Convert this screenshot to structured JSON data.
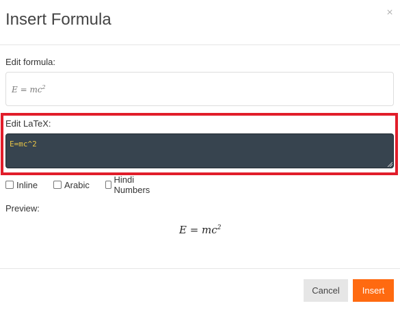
{
  "dialog": {
    "title": "Insert Formula",
    "close_glyph": "×",
    "close_icon": "close-icon"
  },
  "formula": {
    "label": "Edit formula:",
    "rendered_base": "E = mc",
    "rendered_exp": "2"
  },
  "latex": {
    "label": "Edit LaTeX:",
    "value": "E=mc^2",
    "text_color": "#e8c547",
    "background": "#37444f",
    "highlight_color": "#e11d2a"
  },
  "options": [
    {
      "label": "Inline",
      "checked": false
    },
    {
      "label": "Arabic",
      "checked": false
    },
    {
      "label": "Hindi Numbers",
      "checked": false
    }
  ],
  "preview": {
    "label": "Preview:",
    "rendered_base": "E = mc",
    "rendered_exp": "2"
  },
  "footer": {
    "cancel_label": "Cancel",
    "insert_label": "Insert",
    "insert_color": "#ff6a10"
  }
}
